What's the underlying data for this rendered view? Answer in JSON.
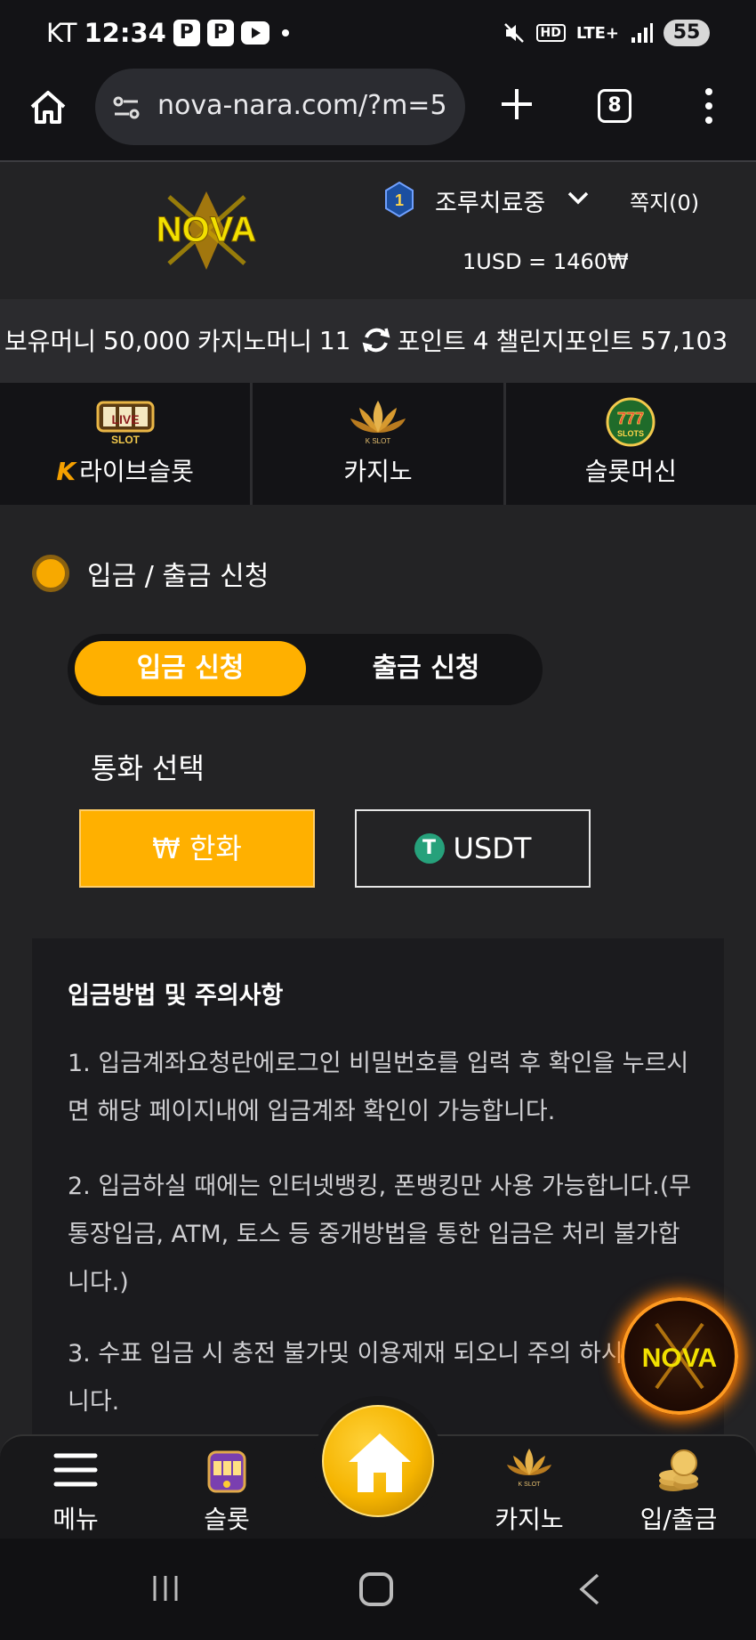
{
  "status_bar": {
    "carrier": "KT",
    "time": "12:34",
    "app_icons": [
      "P",
      "P"
    ],
    "network": "LTE+",
    "hd": "HD",
    "battery": "55"
  },
  "browser": {
    "url": "nova-nara.com/?m=5",
    "tab_count": "8"
  },
  "header": {
    "logo_text": "NOVA",
    "level": "1",
    "username": "조루치료중",
    "messages": "쪽지(0)",
    "exchange_rate": "1USD = 1460₩"
  },
  "money": {
    "holding_label": "보유머니",
    "holding_value": "50,000",
    "casino_label": "카지노머니",
    "casino_value": "11",
    "point_label": "포인트",
    "point_value": "4",
    "challenge_label": "챌린지포인트",
    "challenge_value": "57,103"
  },
  "game_nav": {
    "live_slot_icon_text": "LIVE SLOT",
    "casino_icon_text": "K SLOT",
    "slot_machine_icon_text": "777 SLOTS",
    "items": [
      {
        "label": "라이브슬롯",
        "prefix": "K"
      },
      {
        "label": "카지노"
      },
      {
        "label": "슬롯머신"
      }
    ]
  },
  "section": {
    "title": "입금 / 출금 신청"
  },
  "tabs": {
    "deposit": "입금 신청",
    "withdraw": "출금 신청"
  },
  "currency": {
    "label": "통화 선택",
    "krw": "₩ 한화",
    "usdt": "USDT",
    "tether_symbol": "T"
  },
  "notice": {
    "title": "입금방법 및 주의사항",
    "items": [
      "1. 입금계좌요청란에로그인 비밀번호를 입력 후 확인을 누르시면 해당 페이지내에 입금계좌 확인이 가능합니다.",
      "2. 입금하실 때에는 인터넷뱅킹, 폰뱅킹만 사용 가능합니다.(무통장입금, ATM, 토스 등 중개방법을 통한 입금은 처리 불가합니다.)",
      "3. 수표 입금 시 충전 불가및 이용제재 되오니 주의 하시기 바랍니다."
    ]
  },
  "float_logo_text": "NOVA",
  "bottom_nav": {
    "menu": "메뉴",
    "slot": "슬롯",
    "casino": "카지노",
    "casino_icon_text": "K SLOT",
    "deposit_withdraw": "입/출금"
  },
  "colors": {
    "accent": "#ffb000",
    "background": "#232325",
    "dark": "#131316",
    "notice_bg": "#1b1b1e"
  }
}
